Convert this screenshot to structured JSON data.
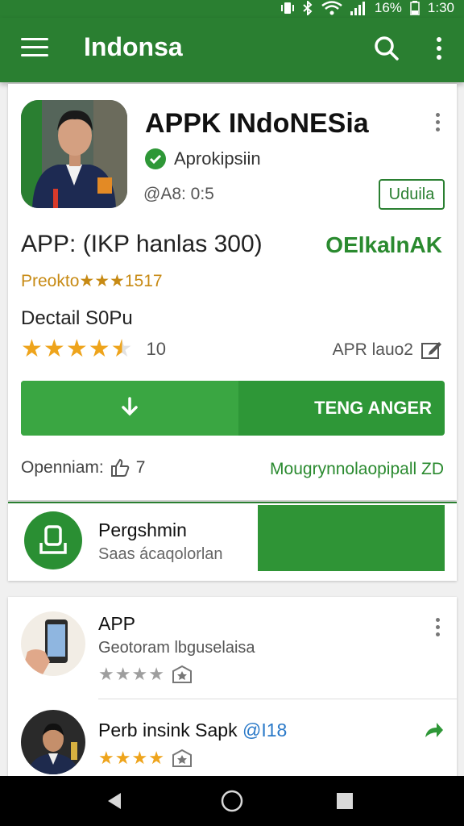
{
  "status_bar": {
    "battery": "16%",
    "time": "1:30"
  },
  "app_bar": {
    "title": "Indonsa"
  },
  "app_card": {
    "name": "APPK INdoNESia",
    "verified_label": "Aprokipsiin",
    "rating_line": "@A8: 0:5",
    "update_button": "Uduila",
    "subtitle": "APP: (IKP hanlas 300)",
    "subtitle_right": "OElkalnAK",
    "promo": "Preokto★★★1517",
    "detail_label": "Dectail S0Pu",
    "stars": 4.5,
    "stars_count": "10",
    "apr_text": "APR lauo2",
    "install_label": "TENG ANGER",
    "opening_text": "Openniam:",
    "opening_icon_text": "7",
    "green_link": "Mougrynnolaopipall ZD"
  },
  "feature_card": {
    "name": "Pergshmin",
    "sub": "Saas ácaqolorlan"
  },
  "list": [
    {
      "title": "APP",
      "sub": "Geotoram lbguselaisa",
      "stars": 4
    },
    {
      "title": "Perb insink Sapk",
      "tag": "@I18",
      "stars": 4
    }
  ],
  "colors": {
    "primary": "#2a7f31",
    "accent_green": "#2e9737",
    "star": "#eea41c",
    "link_blue": "#2a79c8"
  }
}
